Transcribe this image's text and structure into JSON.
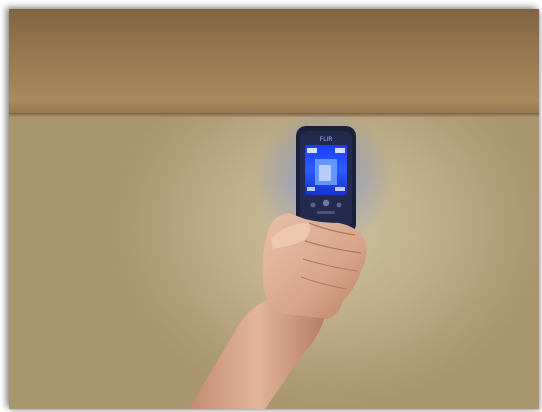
{
  "photo": {
    "device_brand": "FLIR",
    "display_reading_left": "",
    "display_reading_right": ""
  },
  "colors": {
    "ceiling": "#987a52",
    "wall": "#c0b08c",
    "device_body": "#1a1f3a",
    "screen_glow": "#3a6aff",
    "skin": "#d8a48a"
  }
}
